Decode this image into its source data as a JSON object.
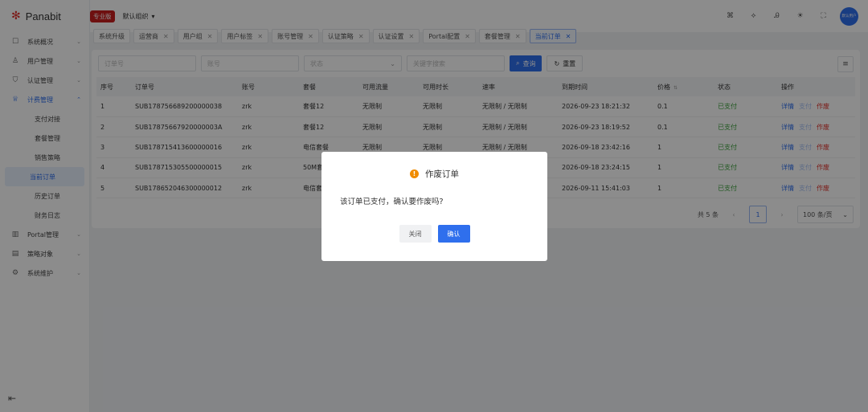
{
  "app": {
    "logo_mark": "✻",
    "name": "Panabit",
    "edition": "专业版",
    "org": "默认组织"
  },
  "header": {
    "icons": [
      "command-icon",
      "diamond-icon",
      "translate-icon",
      "theme-icon",
      "fullscreen-icon"
    ],
    "icon_glyphs": [
      "⌘",
      "⟡",
      "Ꭿ",
      "☀",
      "⛶"
    ],
    "avatar_text": "默认用户"
  },
  "sidebar": {
    "items": [
      {
        "label": "系统概况",
        "icon": "☐"
      },
      {
        "label": "用户管理",
        "icon": "♙"
      },
      {
        "label": "认证管理",
        "icon": "⛉"
      },
      {
        "label": "计费管理",
        "icon": "♕",
        "expanded": true
      },
      {
        "label": "Portal管理",
        "icon": "▥"
      },
      {
        "label": "策略对象",
        "icon": "▤"
      },
      {
        "label": "系统维护",
        "icon": "⚙"
      }
    ],
    "billing_sub": [
      "支付对接",
      "套餐管理",
      "销售策略",
      "当前订单",
      "历史订单",
      "财务日志"
    ],
    "collapse_icon": "⇤"
  },
  "tabs": [
    {
      "label": "系统升级",
      "closable": false
    },
    {
      "label": "运营商",
      "closable": true
    },
    {
      "label": "用户组",
      "closable": true
    },
    {
      "label": "用户标签",
      "closable": true
    },
    {
      "label": "账号管理",
      "closable": true
    },
    {
      "label": "认证策略",
      "closable": true
    },
    {
      "label": "认证设置",
      "closable": true
    },
    {
      "label": "Portal配置",
      "closable": true
    },
    {
      "label": "套餐管理",
      "closable": true
    },
    {
      "label": "当前订单",
      "closable": true,
      "active": true
    }
  ],
  "filters": {
    "order_no_placeholder": "订单号",
    "account_placeholder": "账号",
    "status_placeholder": "状态",
    "keyword_placeholder": "关键字搜索",
    "search_label": "查询",
    "reset_label": "重置"
  },
  "table": {
    "columns": [
      "序号",
      "订单号",
      "账号",
      "套餐",
      "可用流量",
      "可用时长",
      "速率",
      "到期时间",
      "价格",
      "状态",
      "操作"
    ],
    "rows": [
      [
        "1",
        "SUB178756689200000038",
        "zrk",
        "套餐12",
        "无限制",
        "无限制",
        "无限制 / 无限制",
        "2026-09-23 18:21:32",
        "0.1",
        "已支付"
      ],
      [
        "2",
        "SUB17875667920000003A",
        "zrk",
        "套餐12",
        "无限制",
        "无限制",
        "无限制 / 无限制",
        "2026-09-23 18:19:52",
        "0.1",
        "已支付"
      ],
      [
        "3",
        "SUB178715413600000016",
        "zrk",
        "电信套餐",
        "无限制",
        "无限制",
        "无限制 / 无限制",
        "2026-09-18 23:42:16",
        "1",
        "已支付"
      ],
      [
        "4",
        "SUB178715305500000015",
        "zrk",
        "50M套",
        "",
        "",
        "",
        "2026-09-18 23:24:15",
        "1",
        "已支付"
      ],
      [
        "5",
        "SUB178652046300000012",
        "zrk",
        "电信套",
        "",
        "",
        "",
        "2026-09-11 15:41:03",
        "1",
        "已支付"
      ]
    ],
    "actions": [
      "详情",
      "支付",
      "作废"
    ]
  },
  "pagination": {
    "total": "共 5 条",
    "current": "1",
    "page_size": "100 条/页"
  },
  "dialog": {
    "title": "作废订单",
    "message": "该订单已支付，确认要作废吗?",
    "cancel_label": "关闭",
    "ok_label": "确认"
  }
}
